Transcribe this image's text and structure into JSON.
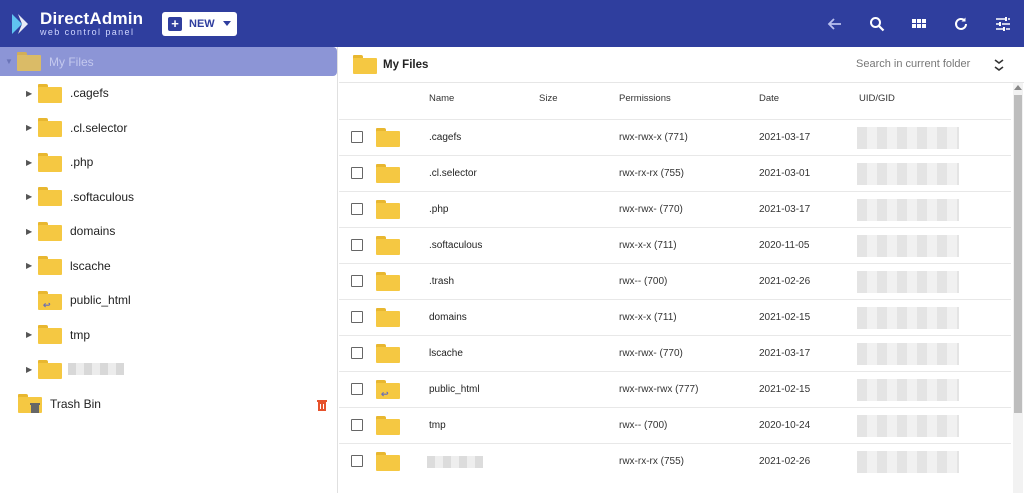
{
  "brand": {
    "title": "DirectAdmin",
    "subtitle": "web control panel"
  },
  "toolbar": {
    "new_label": "NEW"
  },
  "top_icons": [
    "back-arrow-icon",
    "search-icon",
    "grid-icon",
    "refresh-icon",
    "tune-icon"
  ],
  "sidebar": {
    "root_label": "My Files",
    "items": [
      {
        "label": ".cagefs",
        "shared": false
      },
      {
        "label": ".cl.selector",
        "shared": false
      },
      {
        "label": ".php",
        "shared": false
      },
      {
        "label": ".softaculous",
        "shared": false
      },
      {
        "label": "domains",
        "shared": false
      },
      {
        "label": "lscache",
        "shared": false
      },
      {
        "label": "public_html",
        "shared": true
      },
      {
        "label": "tmp",
        "shared": false
      },
      {
        "label": "",
        "shared": false
      }
    ],
    "trash_label": "Trash Bin"
  },
  "main": {
    "title": "My Files",
    "search_placeholder": "Search in current folder",
    "columns": {
      "name": "Name",
      "size": "Size",
      "permissions": "Permissions",
      "date": "Date",
      "uid": "UID/GID"
    },
    "rows": [
      {
        "name": ".cagefs",
        "permissions": "rwx-rwx-x (771)",
        "date": "2021-03-17",
        "shared": false
      },
      {
        "name": ".cl.selector",
        "permissions": "rwx-rx-rx (755)",
        "date": "2021-03-01",
        "shared": false
      },
      {
        "name": ".php",
        "permissions": "rwx-rwx- (770)",
        "date": "2021-03-17",
        "shared": false
      },
      {
        "name": ".softaculous",
        "permissions": "rwx-x-x (711)",
        "date": "2020-11-05",
        "shared": false
      },
      {
        "name": ".trash",
        "permissions": "rwx-- (700)",
        "date": "2021-02-26",
        "shared": false
      },
      {
        "name": "domains",
        "permissions": "rwx-x-x (711)",
        "date": "2021-02-15",
        "shared": false
      },
      {
        "name": "lscache",
        "permissions": "rwx-rwx- (770)",
        "date": "2021-03-17",
        "shared": false
      },
      {
        "name": "public_html",
        "permissions": "rwx-rwx-rwx (777)",
        "date": "2021-02-15",
        "shared": true
      },
      {
        "name": "tmp",
        "permissions": "rwx-- (700)",
        "date": "2020-10-24",
        "shared": false
      },
      {
        "name": "",
        "permissions": "rwx-rx-rx (755)",
        "date": "2021-02-26",
        "shared": false
      }
    ]
  },
  "colors": {
    "header": "#2f3e9e",
    "folder": "#f5c842",
    "selected": "#8c95d6"
  }
}
